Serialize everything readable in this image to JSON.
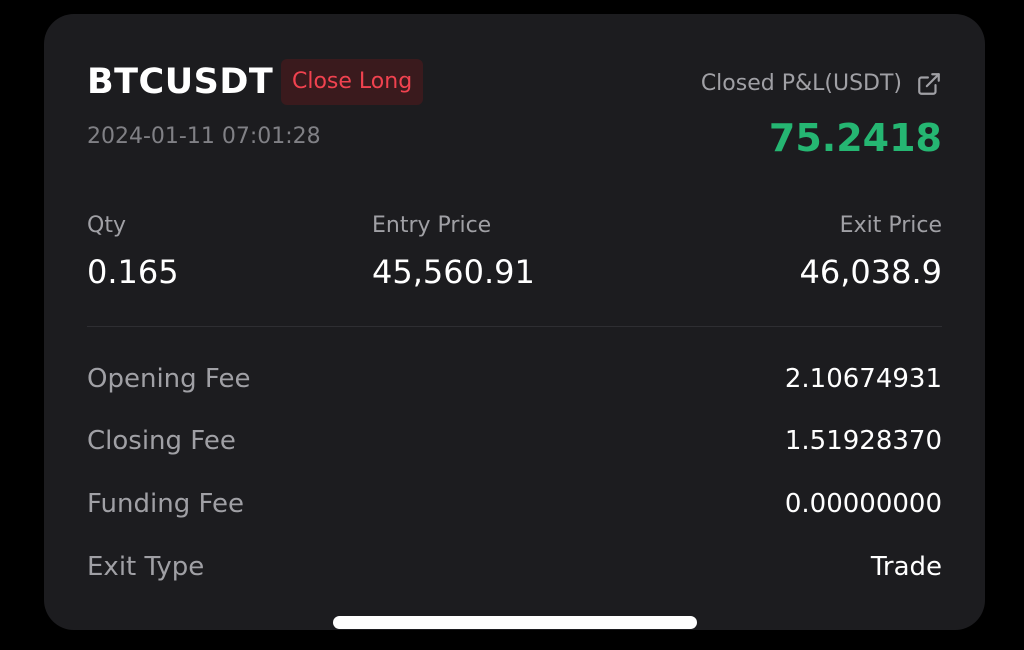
{
  "trade": {
    "symbol": "BTCUSDT",
    "side_badge": "Close Long",
    "timestamp": "2024-01-11 07:01:28",
    "pnl_label": "Closed P&L(USDT)",
    "pnl_value": "75.2418"
  },
  "summary": {
    "qty_label": "Qty",
    "qty_value": "0.165",
    "entry_label": "Entry Price",
    "entry_value": "45,560.91",
    "exit_label": "Exit Price",
    "exit_value": "46,038.9"
  },
  "details": [
    {
      "label": "Opening Fee",
      "value": "2.10674931"
    },
    {
      "label": "Closing Fee",
      "value": "1.51928370"
    },
    {
      "label": "Funding Fee",
      "value": "0.00000000"
    },
    {
      "label": "Exit Type",
      "value": "Trade"
    }
  ],
  "icons": {
    "share": "external-link-icon"
  },
  "colors": {
    "profit": "#25b672",
    "badge_text": "#f0424f",
    "badge_bg": "#3a1a1d",
    "card_bg": "#1c1c1f"
  }
}
